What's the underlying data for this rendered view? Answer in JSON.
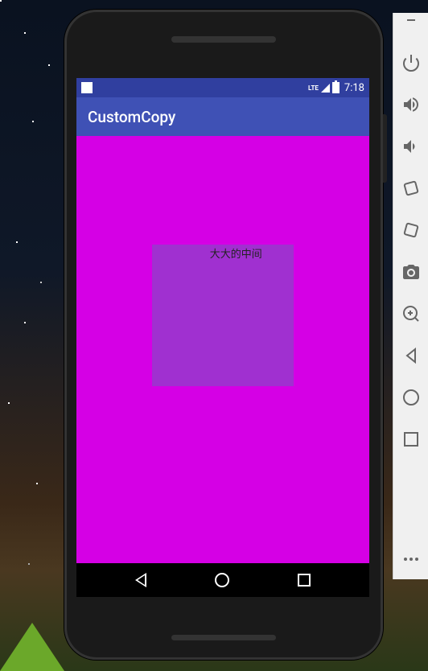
{
  "statusBar": {
    "network": "LTE",
    "time": "7:18"
  },
  "appBar": {
    "title": "CustomCopy"
  },
  "content": {
    "centerLabel": "大大的中间"
  },
  "toolbar": {
    "minimize": "minimize",
    "power": "power",
    "volumeUp": "volume-up",
    "volumeDown": "volume-down",
    "rotateLeft": "rotate-left",
    "rotateRight": "rotate-right",
    "camera": "camera",
    "zoom": "zoom",
    "back": "back",
    "home": "home",
    "recent": "recent",
    "more": "more"
  }
}
